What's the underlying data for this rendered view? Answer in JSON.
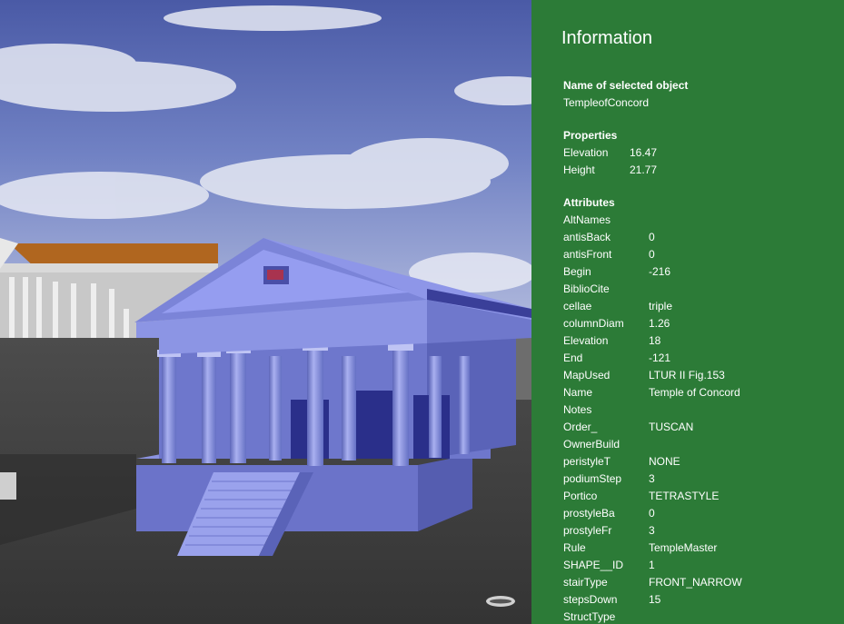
{
  "panel": {
    "title": "Information",
    "selected_label": "Name of selected object",
    "selected_value": "TempleofConcord",
    "properties_label": "Properties",
    "properties": [
      {
        "key": "Elevation",
        "value": "16.47"
      },
      {
        "key": "Height",
        "value": "21.77"
      }
    ],
    "attributes_label": "Attributes",
    "attributes": [
      {
        "key": "AltNames",
        "value": ""
      },
      {
        "key": "antisBack",
        "value": "0"
      },
      {
        "key": "antisFront",
        "value": "0"
      },
      {
        "key": "Begin",
        "value": "-216"
      },
      {
        "key": "BiblioCite",
        "value": ""
      },
      {
        "key": "cellae",
        "value": "triple"
      },
      {
        "key": "columnDiam",
        "value": "1.26"
      },
      {
        "key": "Elevation",
        "value": "18"
      },
      {
        "key": "End",
        "value": "-121"
      },
      {
        "key": "MapUsed",
        "value": "LTUR II Fig.153"
      },
      {
        "key": "Name",
        "value": "Temple of Concord"
      },
      {
        "key": "Notes",
        "value": ""
      },
      {
        "key": "Order_",
        "value": "TUSCAN"
      },
      {
        "key": "OwnerBuild",
        "value": ""
      },
      {
        "key": "peristyleT",
        "value": "NONE"
      },
      {
        "key": "podiumStep",
        "value": "3"
      },
      {
        "key": "Portico",
        "value": "TETRASTYLE"
      },
      {
        "key": "prostyleBa",
        "value": "0"
      },
      {
        "key": "prostyleFr",
        "value": "3"
      },
      {
        "key": "Rule",
        "value": "TempleMaster"
      },
      {
        "key": "SHAPE__ID",
        "value": "1"
      },
      {
        "key": "stairType",
        "value": "FRONT_NARROW"
      },
      {
        "key": "stepsDown",
        "value": "15"
      },
      {
        "key": "StructType",
        "value": ""
      }
    ]
  },
  "colors": {
    "panel_bg": "#2c7b37",
    "sky": "#5b6fb3",
    "ground": "#3b3b3b",
    "temple_blue": "#7b84d8",
    "roof_orange": "#b0661f"
  }
}
